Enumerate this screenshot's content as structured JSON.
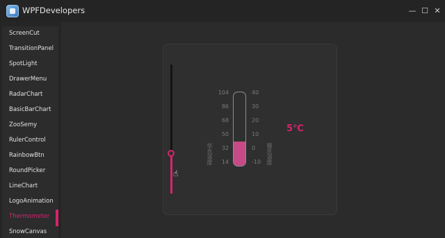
{
  "window": {
    "title": "WPFDevelopers",
    "minimize_glyph": "—",
    "maximize_glyph": "☐",
    "close_glyph": "✕"
  },
  "sidebar": {
    "items": [
      {
        "label": "ScreenCut"
      },
      {
        "label": "TransitionPanel"
      },
      {
        "label": "SpotLight"
      },
      {
        "label": "DrawerMenu"
      },
      {
        "label": "RadarChart"
      },
      {
        "label": "BasicBarChart"
      },
      {
        "label": "ZooSemy"
      },
      {
        "label": "RulerControl"
      },
      {
        "label": "RainbowBtn"
      },
      {
        "label": "RoundPicker"
      },
      {
        "label": "LineChart"
      },
      {
        "label": "LogoAnimation"
      },
      {
        "label": "Thermometer"
      },
      {
        "label": "SnowCanvas"
      }
    ],
    "active": "Thermometer"
  },
  "thermometer": {
    "fahrenheit_label": "华氏温度",
    "celsius_label": "摄氏温度",
    "fahrenheit_ticks": [
      "104",
      "86",
      "68",
      "50",
      "32",
      "14"
    ],
    "celsius_ticks": [
      "40",
      "30",
      "20",
      "10",
      "0",
      "-10"
    ],
    "temperature_text": "5℃",
    "min_celsius": -10,
    "max_celsius": 40,
    "current_celsius": 5,
    "accent_color": "#d6246e",
    "fill_color": "#c44b86"
  }
}
